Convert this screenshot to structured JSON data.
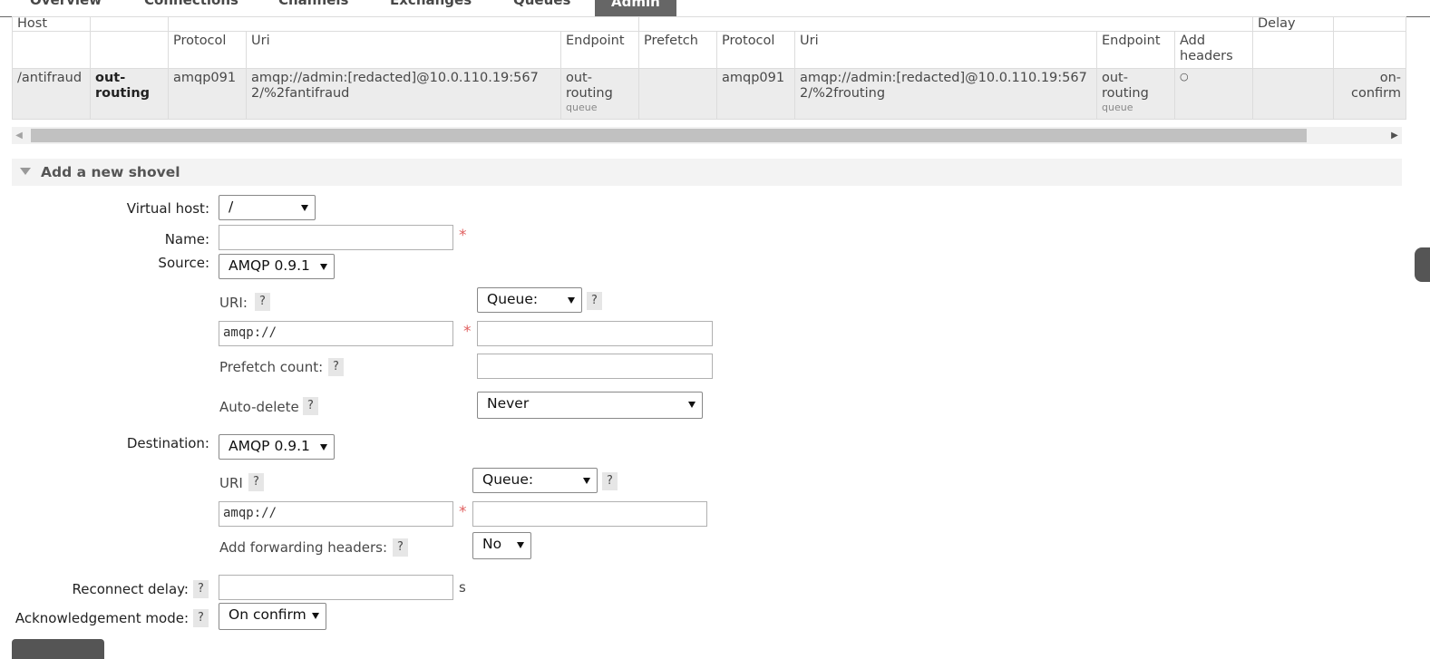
{
  "nav": {
    "tabs": [
      {
        "label": "Overview",
        "active": false
      },
      {
        "label": "Connections",
        "active": false
      },
      {
        "label": "Channels",
        "active": false
      },
      {
        "label": "Exchanges",
        "active": false
      },
      {
        "label": "Queues",
        "active": false
      },
      {
        "label": "Admin",
        "active": true
      }
    ]
  },
  "table": {
    "group_headers": {
      "host": "Host",
      "delay": "Delay"
    },
    "columns": [
      "Protocol",
      "Uri",
      "Endpoint",
      "Prefetch",
      "Protocol",
      "Uri",
      "Endpoint",
      "Add headers"
    ],
    "row": {
      "vhost": "/antifraud",
      "name": "out-routing",
      "src_protocol": "amqp091",
      "src_uri": "amqp://admin:[redacted]@10.0.110.19:5672/%2fantifraud",
      "src_endpoint": "out-routing",
      "src_endpoint_type": "queue",
      "src_prefetch": "",
      "dest_protocol": "amqp091",
      "dest_uri": "amqp://admin:[redacted]@10.0.110.19:5672/%2frouting",
      "dest_endpoint": "out-routing",
      "dest_endpoint_type": "queue",
      "add_headers": "○",
      "delay": "",
      "ack_mode": "on-confirm"
    }
  },
  "form": {
    "section_title": "Add a new shovel",
    "virtual_host": {
      "label": "Virtual host:",
      "value": "/"
    },
    "name": {
      "label": "Name:",
      "value": ""
    },
    "required_mark": "*",
    "help_mark": "?",
    "source": {
      "label": "Source:",
      "protocol": "AMQP 0.9.1",
      "uri_label": "URI:",
      "uri_value": "amqp://",
      "queue_select": "Queue:",
      "queue_value": "",
      "prefetch_label": "Prefetch count:",
      "prefetch_value": "",
      "autodelete_label": "Auto-delete",
      "autodelete_value": "Never"
    },
    "destination": {
      "label": "Destination:",
      "protocol": "AMQP 0.9.1",
      "uri_label": "URI",
      "uri_value": "amqp://",
      "queue_select": "Queue:",
      "queue_value": "",
      "fwd_headers_label": "Add forwarding headers:",
      "fwd_headers_value": "No"
    },
    "reconnect_delay": {
      "label": "Reconnect delay:",
      "value": "",
      "unit": "s"
    },
    "ack_mode": {
      "label": "Acknowledgement mode:",
      "value": "On confirm"
    }
  }
}
